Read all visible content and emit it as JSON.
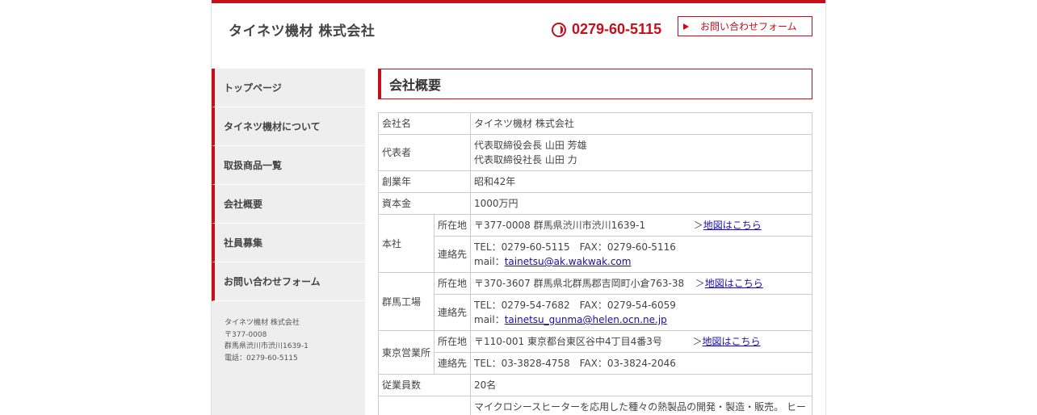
{
  "header": {
    "site_title": "タイネツ機材 株式会社",
    "phone": "0279-60-5115",
    "contact_button": "お問い合わせフォーム"
  },
  "sidebar": {
    "items": [
      {
        "label": "トップページ"
      },
      {
        "label": "タイネツ機材について"
      },
      {
        "label": "取扱商品一覧"
      },
      {
        "label": "会社概要"
      },
      {
        "label": "社員募集"
      },
      {
        "label": "お問い合わせフォーム"
      }
    ],
    "address": {
      "company": "タイネツ機材 株式会社",
      "zip": "〒377-0008",
      "addr": "群馬県渋川市渋川1639-1",
      "tel": "電話：0279-60-5115"
    }
  },
  "main": {
    "heading": "会社概要",
    "rows": {
      "name_label": "会社名",
      "name_value": "タイネツ機材 株式会社",
      "rep_label": "代表者",
      "rep_value_1": "代表取締役会長 山田 芳雄",
      "rep_value_2": "代表取締役社長 山田 力",
      "founded_label": "創業年",
      "founded_value": "昭和42年",
      "capital_label": "資本金",
      "capital_value": "1000万円",
      "hq_label": "本社",
      "loc_label": "所在地",
      "contact_label": "連絡先",
      "hq_address": "〒377-0008 群馬県渋川市渋川1639-1",
      "hq_tel": "TEL：0279-60-5115　FAX：0279-60-5116",
      "hq_mail_prefix": "mail：",
      "hq_mail": "tainetsu@ak.wakwak.com",
      "gunma_label": "群馬工場",
      "gunma_address": "〒370-3607 群馬県北群馬郡吉岡町小倉763-38",
      "gunma_tel": "TEL：0279-54-7682　FAX：0279-54-6059",
      "gunma_mail_prefix": "mail：",
      "gunma_mail": "tainetsu_gunma@helen.ocn.ne.jp",
      "tokyo_label": "東京営業所",
      "tokyo_address": "〒110-001 東京都台東区谷中4丁目4番3号",
      "tokyo_tel": "TEL：03-3828-4758　FAX：03-3824-2046",
      "map_arrow": "＞",
      "map_link": "地図はこちら",
      "employees_label": "従業員数",
      "employees_value": "20名",
      "business_value": "マイクロシースヒーターを応用した種々の熱製品の開発・製造・販売。 ヒー"
    }
  },
  "colors": {
    "accent": "#c50f1a",
    "sidebar_bg": "#eeeeee",
    "link": "#1a0dab"
  }
}
